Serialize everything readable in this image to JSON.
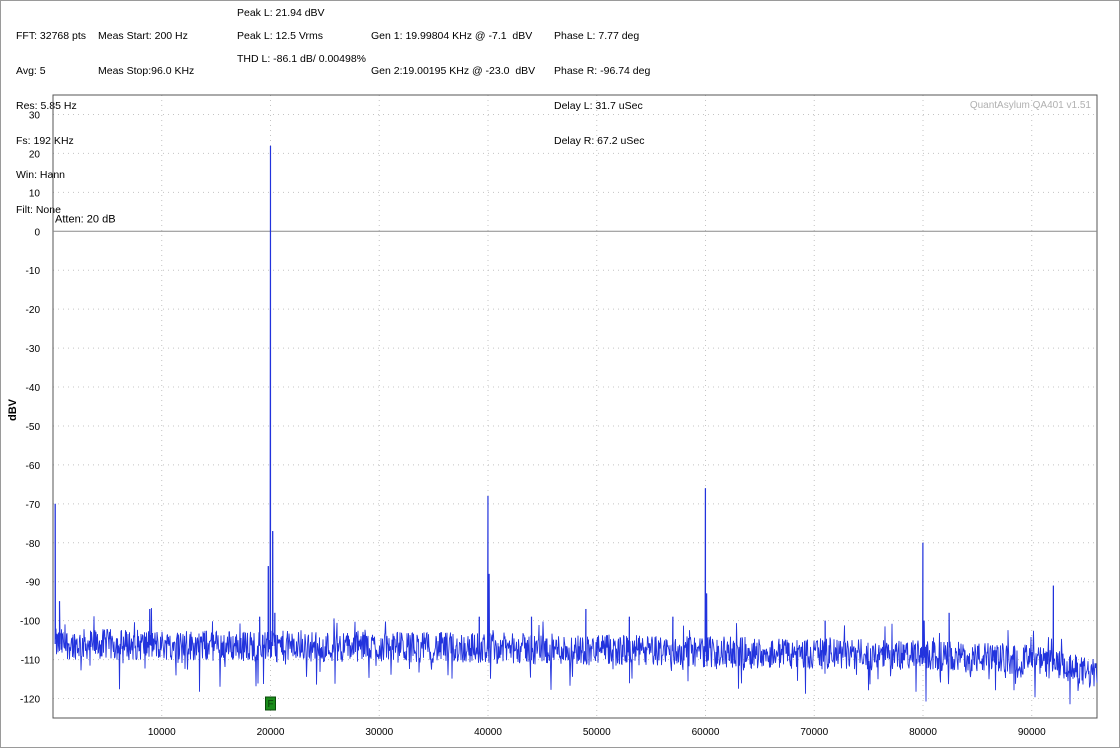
{
  "header": {
    "col1": [
      "FFT: 32768 pts",
      "Avg: 5",
      "Res: 5.85 Hz",
      "Fs: 192 KHz",
      "Win: Hann",
      "Filt: None"
    ],
    "col2": [
      "Meas Start: 200 Hz",
      "Meas Stop:96.0 KHz"
    ],
    "peak_l": "Peak L: 21.94 dBV",
    "peak_vrms": "Peak L: 12.5 Vrms",
    "thd": "THD L: -86.1 dB/ 0.00498%",
    "gen": [
      "Gen 1: 19.99804 KHz @ -7.1  dBV",
      "Gen 2:19.00195 KHz @ -23.0  dBV"
    ],
    "phase": [
      "Phase L: 7.77 deg",
      "Phase R: -96.74 deg",
      "Delay L: 31.7 uSec",
      "Delay R: 67.2 uSec"
    ]
  },
  "chart_data": {
    "type": "line",
    "title": "",
    "ylabel": "dBV",
    "xlabel": "",
    "xlim": [
      0,
      96000
    ],
    "ylim": [
      -125,
      35
    ],
    "x_ticks": [
      10000,
      20000,
      30000,
      40000,
      50000,
      60000,
      70000,
      80000,
      90000
    ],
    "y_ticks": [
      30,
      20,
      10,
      0,
      -10,
      -20,
      -30,
      -40,
      -50,
      -60,
      -70,
      -80,
      -90,
      -100,
      -110,
      -120
    ],
    "grid": true,
    "series": [
      {
        "color": "#2233dd",
        "noise_floor": [
          [
            200,
            -106
          ],
          [
            20000,
            -106.5
          ],
          [
            40000,
            -107
          ],
          [
            60000,
            -108
          ],
          [
            80000,
            -109
          ],
          [
            90000,
            -110
          ],
          [
            96000,
            -114
          ]
        ],
        "peaks": [
          {
            "x": 200,
            "y": -70
          },
          {
            "x": 600,
            "y": -95
          },
          {
            "x": 8900,
            "y": -97
          },
          {
            "x": 19002,
            "y": -99
          },
          {
            "x": 19800,
            "y": -86
          },
          {
            "x": 19998,
            "y": 21.94
          },
          {
            "x": 20200,
            "y": -77
          },
          {
            "x": 20400,
            "y": -98
          },
          {
            "x": 39200,
            "y": -99
          },
          {
            "x": 39996,
            "y": -68
          },
          {
            "x": 40100,
            "y": -88
          },
          {
            "x": 44000,
            "y": -99
          },
          {
            "x": 49000,
            "y": -97
          },
          {
            "x": 53000,
            "y": -99
          },
          {
            "x": 57000,
            "y": -99
          },
          {
            "x": 59994,
            "y": -66
          },
          {
            "x": 60100,
            "y": -93
          },
          {
            "x": 71000,
            "y": -100
          },
          {
            "x": 79992,
            "y": -80
          },
          {
            "x": 80100,
            "y": -100
          },
          {
            "x": 82400,
            "y": -98
          },
          {
            "x": 91990,
            "y": -91
          }
        ]
      }
    ],
    "annotations": {
      "attenuation": "Atten: 20 dB",
      "watermark": "QuantAsylum QA401 v1.51",
      "marker_label": "F",
      "marker_x": 20000
    },
    "marker_color": "#1a8c1a"
  }
}
